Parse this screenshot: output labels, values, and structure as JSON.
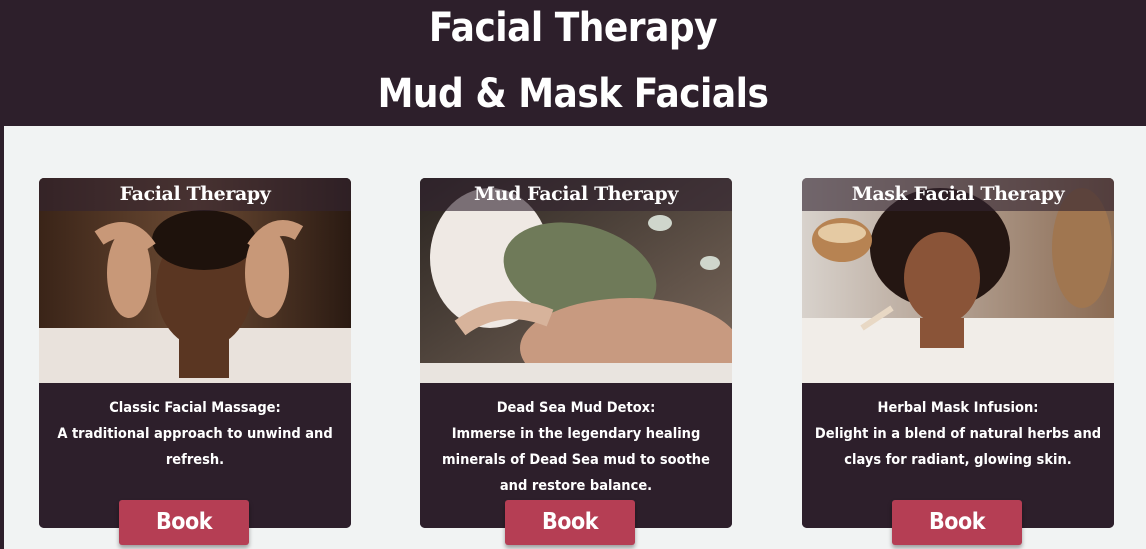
{
  "header": {
    "title": "Facial Therapy",
    "subtitle": "Mud & Mask Facials"
  },
  "cards": [
    {
      "title": "Facial Therapy",
      "heading": "Classic Facial Massage:",
      "description": "A traditional approach to unwind and refresh.",
      "button": "Book"
    },
    {
      "title": "Mud Facial Therapy",
      "heading": "Dead Sea Mud Detox:",
      "description": "Immerse in the legendary healing minerals of Dead Sea mud to soothe and restore balance.",
      "button": "Book"
    },
    {
      "title": "Mask Facial Therapy",
      "heading": "Herbal Mask Infusion:",
      "description": "Delight in a blend of natural herbs and clays for radiant, glowing skin.",
      "button": "Book"
    }
  ],
  "colors": {
    "header_bg": "#2d1f2b",
    "page_bg": "#f1f3f3",
    "card_bg": "#2d1f2b",
    "button_bg": "#b53e54"
  }
}
